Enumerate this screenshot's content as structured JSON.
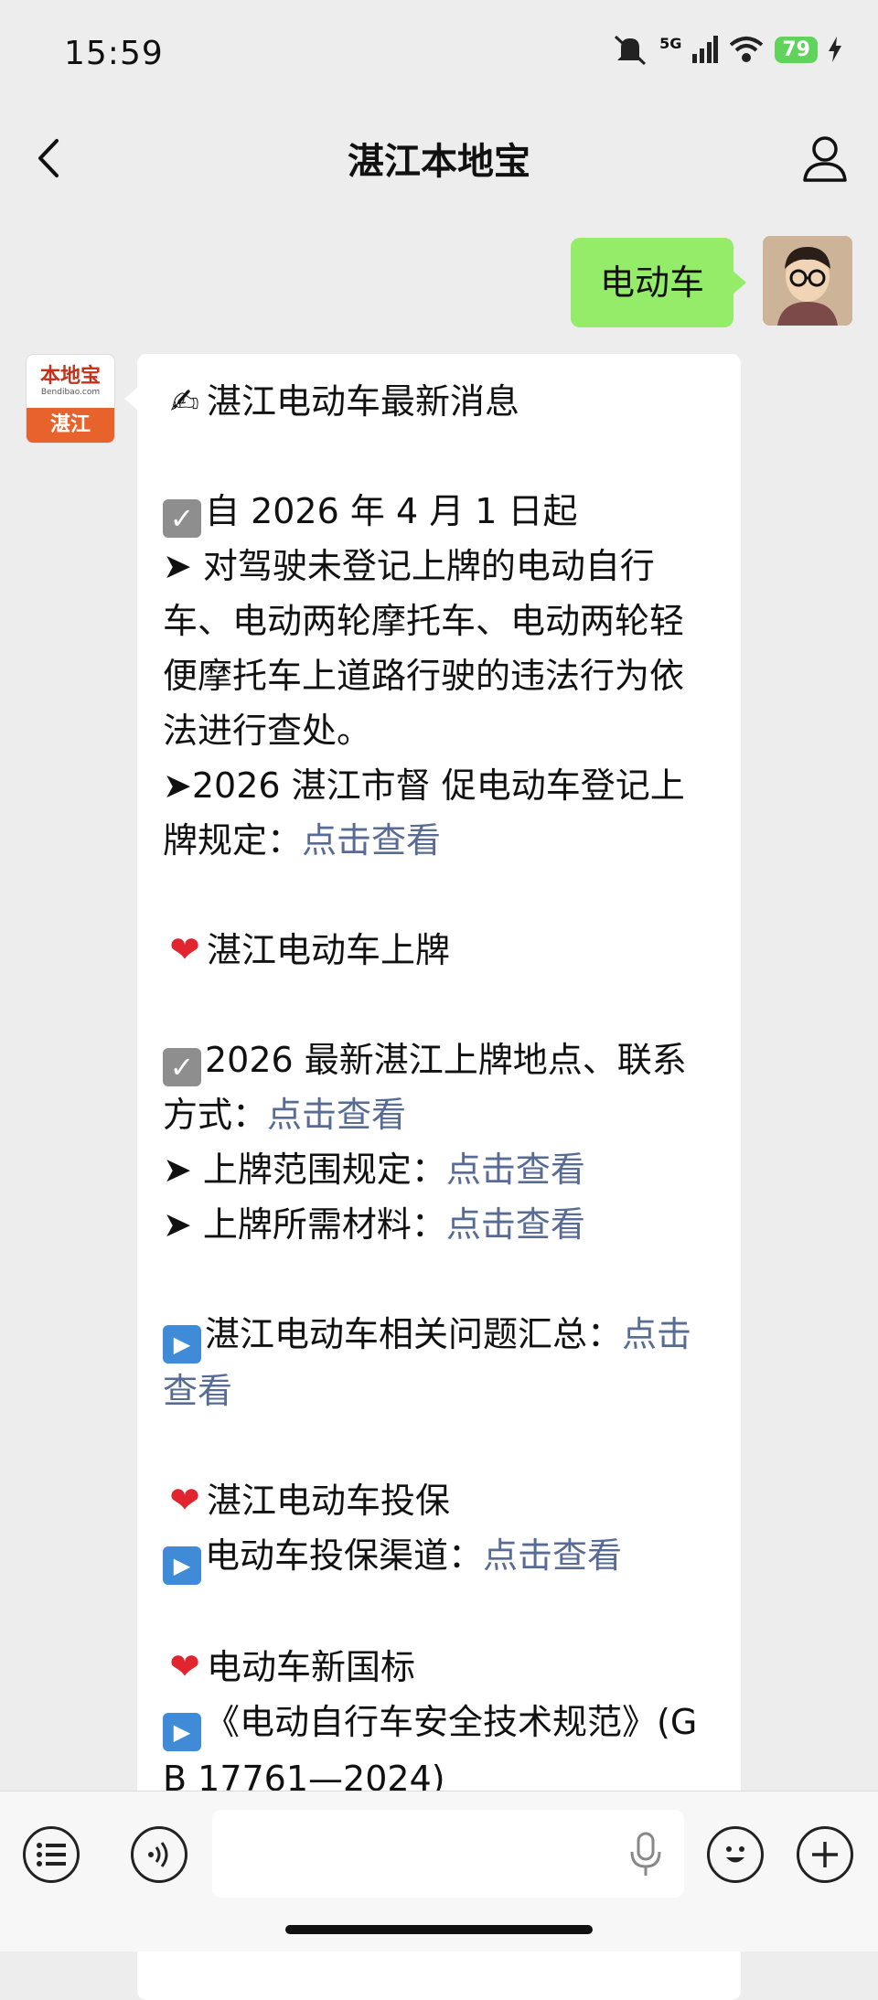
{
  "status_bar": {
    "time": "15:59",
    "network": "5G",
    "battery": "79"
  },
  "nav": {
    "title": "湛江本地宝"
  },
  "user_message": {
    "text": "电动车"
  },
  "bot_avatar": {
    "brand": "本地宝",
    "site": "Bendibao.com",
    "city": "湛江"
  },
  "bot_message": {
    "l1": "湛江电动车最新消息",
    "l2": "自 2026 年 4 月 1 日起",
    "l3": "➤ 对驾驶未登记上牌的电动自行车、电动两轮摩托车、电动两轮轻便摩托车上道路行驶的违法行为依法进行查处。",
    "l4_text": "➤2026 湛江市督 促电动车登记上牌规定：",
    "l4_link": "点击查看",
    "l5": "湛江电动车上牌",
    "l6_text": "2026 最新湛江上牌地点、联系方式：",
    "l6_link": "点击查看",
    "l7_text": "➤ 上牌范围规定：",
    "l7_link": "点击查看",
    "l8_text": "➤ 上牌所需材料：",
    "l8_link": "点击查看",
    "l9_text": "湛江电动车相关问题汇总：",
    "l9_link": "点击查看",
    "l10": "湛江电动车投保",
    "l11_text": "电动车投保渠道：",
    "l11_link": "点击查看",
    "l12": "电动车新国标",
    "l13": "《电动自行车安全技术规范》(GB 17761—2024)"
  },
  "input": {
    "placeholder": ""
  }
}
